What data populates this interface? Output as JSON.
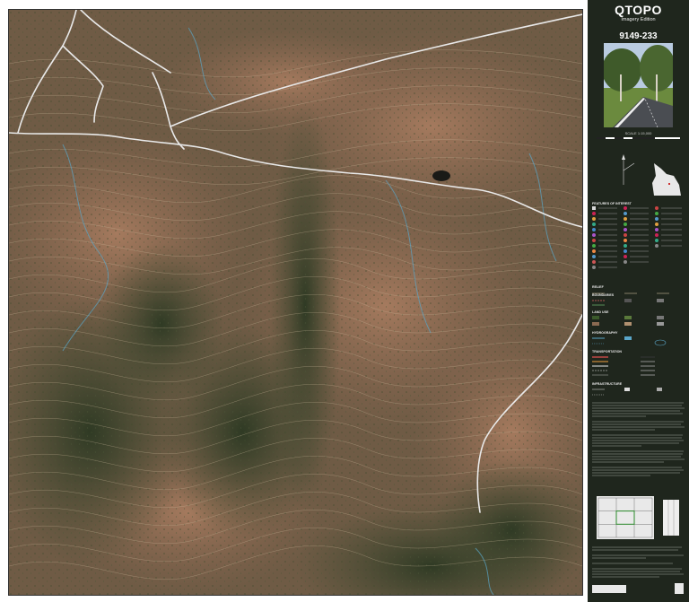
{
  "panel": {
    "title": "QTOPO",
    "subtitle": "Imagery Edition",
    "sheet_number": "9149-233",
    "scale": "SCALE 1:15,000",
    "sections": [
      {
        "label": "FEATURES OF INTEREST"
      },
      {
        "label": "RELIEF"
      },
      {
        "label": "BOUNDARIES"
      },
      {
        "label": "LAND USE"
      },
      {
        "label": "HYDROGRAPHY"
      },
      {
        "label": "TRANSPORTATION"
      },
      {
        "label": "INFRASTRUCTURE"
      }
    ]
  },
  "colors": {
    "panel_bg": "#1f261d",
    "road": "#e9e9e9",
    "contour": "#c9b89a",
    "water": "#5aa6c9",
    "terrain_light": "#8e6a52",
    "terrain_dark": "#3f4a30"
  }
}
